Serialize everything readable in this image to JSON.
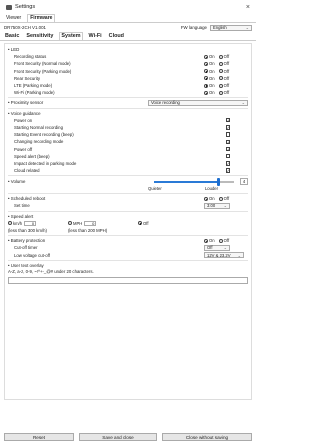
{
  "window": {
    "title": "Settings",
    "close": "×"
  },
  "top_tabs": [
    "Viewer",
    "Firmware"
  ],
  "model": "DR750X-2CH V1.001",
  "fw_language": {
    "label": "FW language",
    "value": "English"
  },
  "tabs": [
    "Basic",
    "Sensitivity",
    "System",
    "Wi-Fi",
    "Cloud"
  ],
  "led": {
    "title": "LED",
    "items": [
      {
        "label": "Recording status",
        "on": true
      },
      {
        "label": "Front Security (Normal mode)",
        "on": true
      },
      {
        "label": "Front Security (Parking mode)",
        "on": true
      },
      {
        "label": "Rear Security",
        "on": true
      },
      {
        "label": "LTE (Parking mode)",
        "on": true
      },
      {
        "label": "Wi-Fi (Parking mode)",
        "on": true
      }
    ]
  },
  "radio_on": "On",
  "radio_off": "Off",
  "proximity": {
    "label": "Proximity sensor",
    "value": "Voice recording"
  },
  "voice": {
    "title": "Voice guidance",
    "items": [
      {
        "label": "Power on",
        "checked": true
      },
      {
        "label": "Starting Normal recording",
        "checked": true
      },
      {
        "label": "Starting Event recording (beep)",
        "checked": false
      },
      {
        "label": "Changing recording mode",
        "checked": true
      },
      {
        "label": "Power off",
        "checked": true
      },
      {
        "label": "Speed alert (beep)",
        "checked": false
      },
      {
        "label": "Impact detected in parking mode",
        "checked": true
      },
      {
        "label": "Cloud related",
        "checked": true
      }
    ]
  },
  "volume": {
    "label": "Volume",
    "value": "4",
    "min_label": "Quieter",
    "max_label": "Louder",
    "level": 0.8
  },
  "reboot": {
    "label": "Scheduled reboot",
    "set_time_label": "Set time",
    "set_time": "3:00"
  },
  "speed": {
    "label": "Speed alert",
    "kmh_label": "km/h",
    "kmh_value": "0",
    "kmh_hint": "(less than 300 km/h)",
    "mph_label": "MPH",
    "mph_value": "0",
    "mph_hint": "(less than 200 MPH)",
    "off_label": "Off"
  },
  "battery": {
    "label": "Battery protection",
    "cutoff_label": "Cut-off timer",
    "cutoff_value": "Off",
    "lowvolt_label": "Low voltage cut-off",
    "lowvolt_value": "12V & 23.2V"
  },
  "overlay": {
    "label": "User text overlay",
    "hint": "A-Z, a-z, 0-9, ~!^+-_@# under 20 characters."
  },
  "buttons": {
    "reset": "Reset",
    "save": "Save and close",
    "close": "Close without saving"
  }
}
